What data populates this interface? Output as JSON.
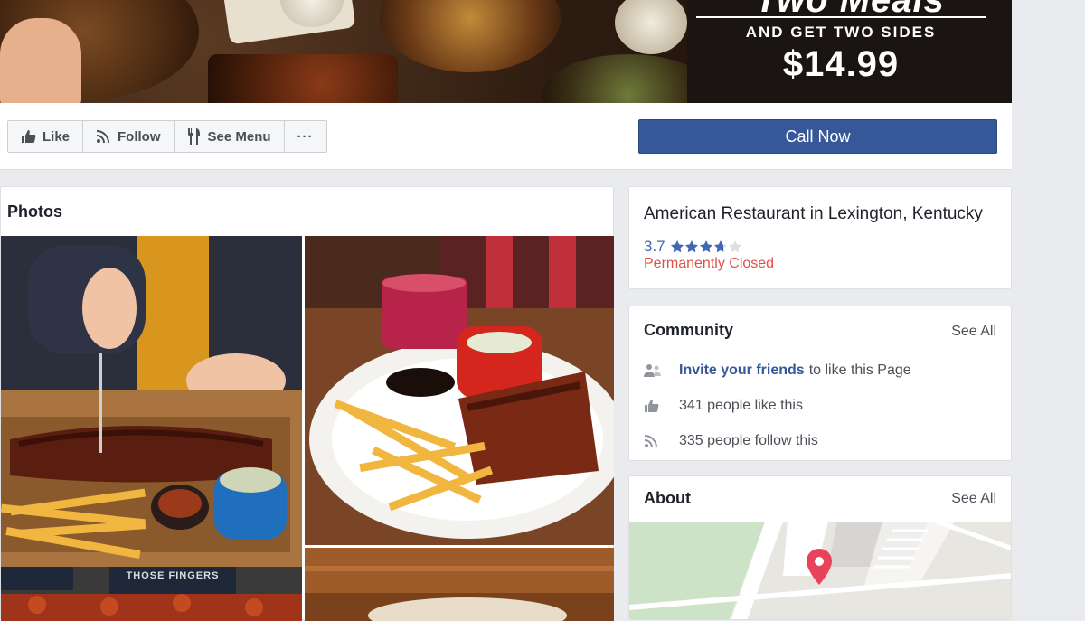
{
  "promo": {
    "title": "Two Meals",
    "subtitle": "AND GET TWO SIDES",
    "price": "$14.99"
  },
  "actions": {
    "like_label": "Like",
    "follow_label": "Follow",
    "menu_label": "See Menu",
    "more_label": "···",
    "call_label": "Call Now"
  },
  "photos": {
    "title": "Photos",
    "photo3_text": "THOSE FINGERS"
  },
  "info": {
    "category": "American Restaurant in Lexington, Kentucky",
    "rating": "3.7",
    "rating_value": 3.7,
    "rating_max": 5,
    "status": "Permanently Closed"
  },
  "community": {
    "title": "Community",
    "see_all": "See All",
    "invite_link": "Invite your friends",
    "invite_rest": "to like this Page",
    "likes": "341 people like this",
    "follows": "335 people follow this"
  },
  "about": {
    "title": "About",
    "see_all": "See All"
  },
  "colors": {
    "brand_blue": "#365899",
    "link_blue": "#4267b2",
    "closed_red": "#e0504a",
    "map_pin": "#e8435a"
  }
}
